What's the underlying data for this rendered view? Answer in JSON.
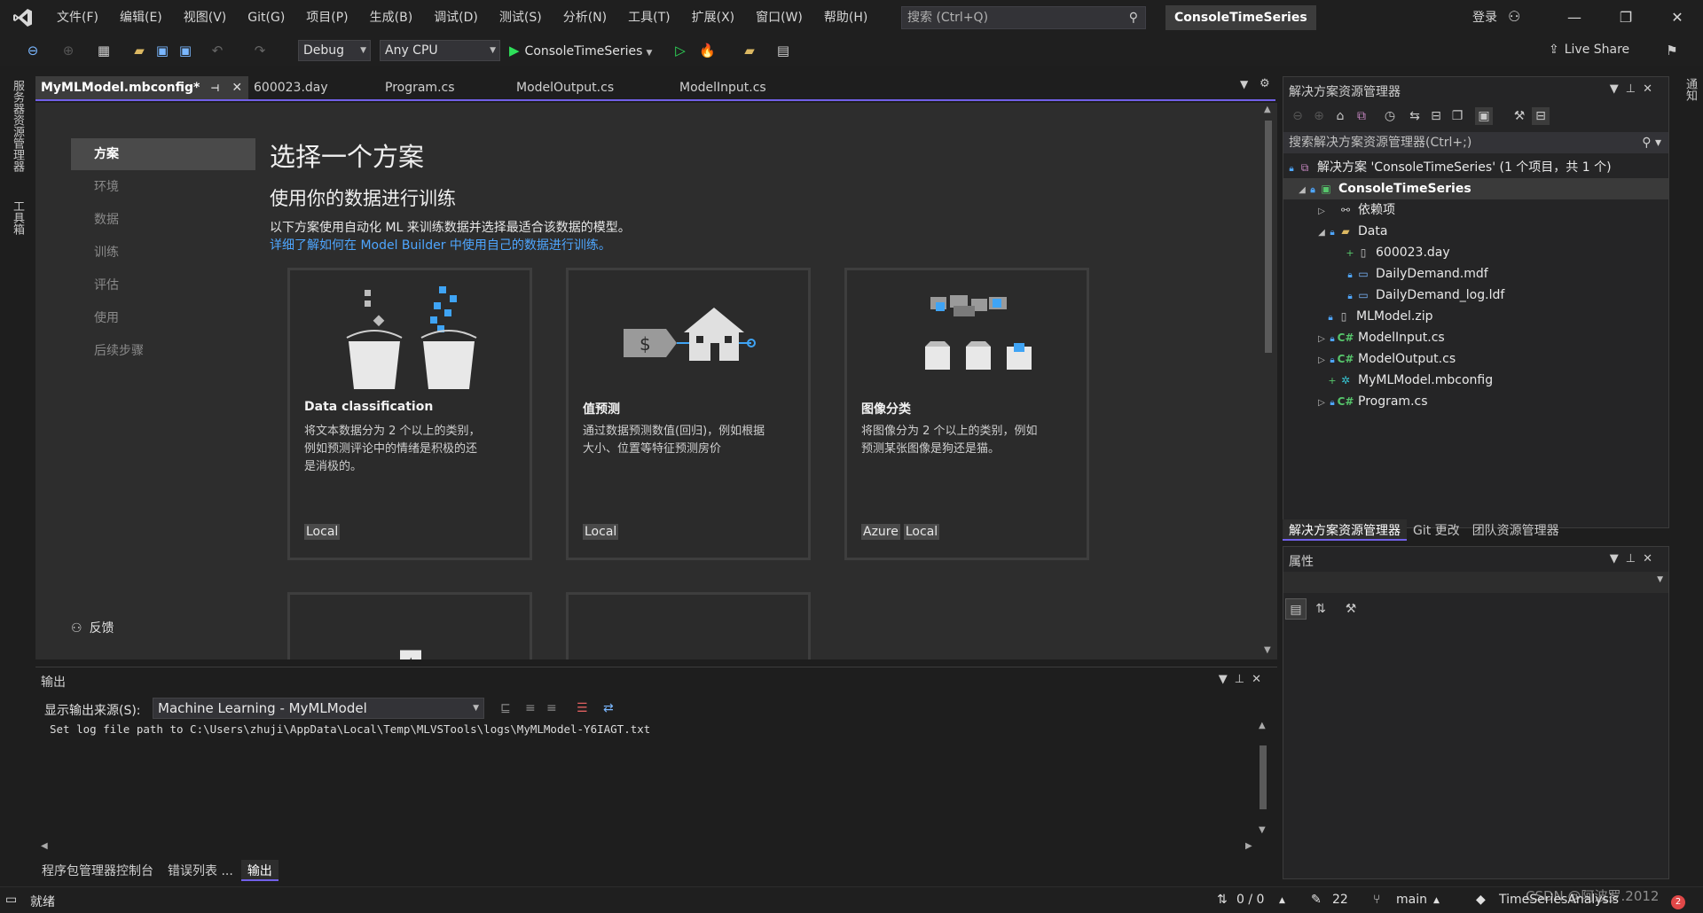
{
  "menu": {
    "items": [
      "文件(F)",
      "编辑(E)",
      "视图(V)",
      "Git(G)",
      "项目(P)",
      "生成(B)",
      "调试(D)",
      "测试(S)",
      "分析(N)",
      "工具(T)",
      "扩展(X)",
      "窗口(W)",
      "帮助(H)"
    ],
    "search_placeholder": "搜索 (Ctrl+Q)",
    "solution_name": "ConsoleTimeSeries",
    "signin": "登录"
  },
  "toolbar": {
    "config": "Debug",
    "platform": "Any CPU",
    "run_target": "ConsoleTimeSeries",
    "live_share": "Live Share"
  },
  "left_strip": {
    "server_explorer": "服务器资源管理器",
    "toolbox": "工具箱"
  },
  "right_strip": {
    "notifications": "通知"
  },
  "doc_tabs": [
    {
      "label": "MyMLModel.mbconfig*"
    },
    {
      "label": "600023.day"
    },
    {
      "label": "Program.cs"
    },
    {
      "label": "ModelOutput.cs"
    },
    {
      "label": "ModelInput.cs"
    }
  ],
  "model_builder": {
    "nav": [
      "方案",
      "环境",
      "数据",
      "训练",
      "评估",
      "使用",
      "后续步骤"
    ],
    "feedback": "反馈",
    "title": "选择一个方案",
    "subtitle": "使用你的数据进行训练",
    "description": "以下方案使用自动化 ML 来训练数据并选择最适合该数据的模型。",
    "link": "详细了解如何在 Model Builder 中使用自己的数据进行训练。",
    "cards": [
      {
        "title": "Data classification",
        "desc_lines": [
          "将文本数据分为 2 个以上的类别，",
          "例如预测评论中的情绪是积极的还",
          "是消极的。"
        ],
        "tags": [
          "Local"
        ]
      },
      {
        "title": "值预测",
        "desc_lines": [
          "通过数据预测数值(回归)，例如根据",
          "大小、位置等特征预测房价"
        ],
        "tags": [
          "Local"
        ]
      },
      {
        "title": "图像分类",
        "desc_lines": [
          "将图像分为 2 个以上的类别，例如",
          "预测某张图像是狗还是猫。"
        ],
        "tags": [
          "Azure",
          "Local"
        ]
      }
    ]
  },
  "output": {
    "title": "输出",
    "source_label": "显示输出来源(S):",
    "source_value": "Machine Learning - MyMLModel",
    "text": "Set log file path to C:\\Users\\zhuji\\AppData\\Local\\Temp\\MLVSTools\\logs\\MyMLModel-Y6IAGT.txt"
  },
  "bottom_tabs": [
    "程序包管理器控制台",
    "错误列表 ...",
    "输出"
  ],
  "solution_explorer": {
    "title": "解决方案资源管理器",
    "search_placeholder": "搜索解决方案资源管理器(Ctrl+;)",
    "tree": [
      {
        "label": "解决方案 'ConsoleTimeSeries' (1 个项目，共 1 个)",
        "icon": "solution-icon"
      },
      {
        "label": "ConsoleTimeSeries",
        "icon": "project-icon"
      },
      {
        "label": "依赖项",
        "icon": "dependencies-icon"
      },
      {
        "label": "Data",
        "icon": "folder-icon"
      },
      {
        "label": "600023.day",
        "icon": "file-icon"
      },
      {
        "label": "DailyDemand.mdf",
        "icon": "database-icon"
      },
      {
        "label": "DailyDemand_log.ldf",
        "icon": "database-icon"
      },
      {
        "label": "MLModel.zip",
        "icon": "file-icon"
      },
      {
        "label": "ModelInput.cs",
        "icon": "csharp-icon"
      },
      {
        "label": "ModelOutput.cs",
        "icon": "csharp-icon"
      },
      {
        "label": "MyMLModel.mbconfig",
        "icon": "mbconfig-icon"
      },
      {
        "label": "Program.cs",
        "icon": "csharp-icon"
      }
    ],
    "tabs": [
      "解决方案资源管理器",
      "Git 更改",
      "团队资源管理器"
    ]
  },
  "properties": {
    "title": "属性"
  },
  "statusbar": {
    "ready": "就绪",
    "changes": "0 / 0",
    "edits": "22",
    "branch": "main",
    "repo": "TimeSeriesAnalysis",
    "watermark": "CSDN @阿波罗.2012",
    "notification_count": "2"
  },
  "colors": {
    "accent": "#7160e8",
    "link": "#4ea6ff",
    "run": "#2ee05a"
  }
}
